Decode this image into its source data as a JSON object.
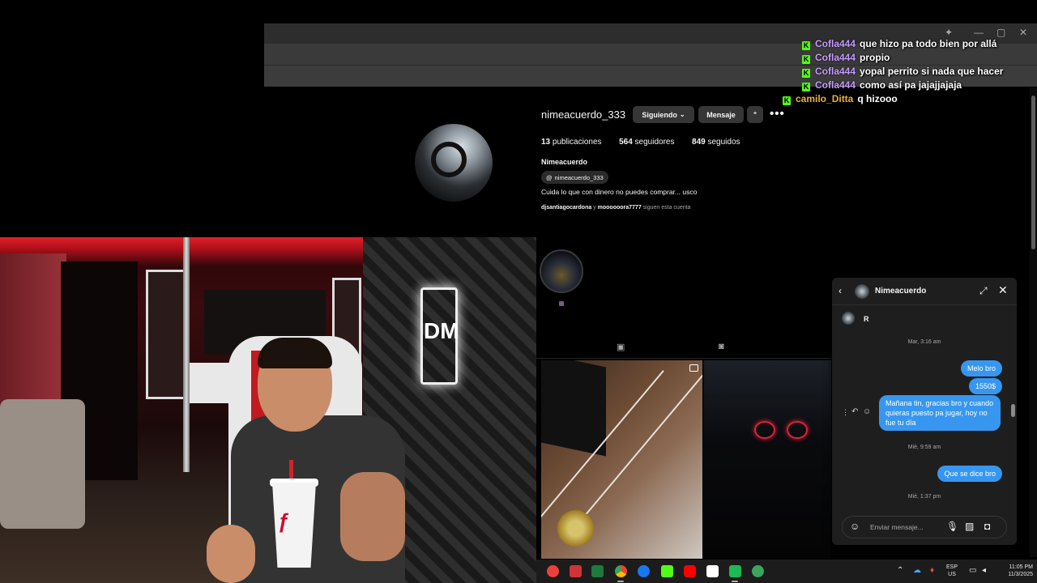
{
  "chat": [
    {
      "user": "Cofla444",
      "message": "que hizo pa todo bien por allá"
    },
    {
      "user": "Cofla444",
      "message": "propio"
    },
    {
      "user": "Cofla444",
      "message": "yopal perrito si nada que hacer"
    },
    {
      "user": "Cofla444",
      "message": "como así pa jajajjajaja"
    },
    {
      "user": "camilo_Ditta",
      "message": "q hizooo"
    }
  ],
  "chat_badge": "K",
  "profile": {
    "username": "nimeacuerdo_333",
    "following_button": "Siguiendo",
    "message_button": "Mensaje",
    "posts_count": "13",
    "posts_label": "publicaciones",
    "followers_count": "564",
    "followers_label": "seguidores",
    "following_count": "849",
    "following_label": "seguidos",
    "display_name": "Nimeacuerdo",
    "threads_handle": "nimeacuerdo_333",
    "bio": "Cuida lo que con dinero no puedes comprar... usco",
    "followed_by_1": "djsantiagocardona",
    "followed_by_sep": "y",
    "followed_by_2": "moooooora7777",
    "followed_by_suffix": "siguen esta cuenta"
  },
  "dm": {
    "contact_name": "Nimeacuerdo",
    "first_message": "R",
    "timestamps": [
      "Mar, 3:16 am",
      "Mié, 9:59 am",
      "Mié, 1:37 pm"
    ],
    "sent_messages": [
      "Melo bro",
      "1550$",
      "Mañana tin, gracias bro y cuando quieras puesto pa jugar, hoy no fue tu día",
      "Que se dice bro"
    ],
    "input_placeholder": "Enviar mensaje..."
  },
  "cam": {
    "wall_logo": "DM"
  },
  "taskbar": {
    "language": "ESP",
    "region": "US",
    "time": "11:05 PM",
    "date": "11/3/2025"
  },
  "colors": {
    "accent_blue": "#3797f0",
    "kick_green": "#53fc18",
    "chat_user": "#c79bff",
    "chat_user_alt": "#e8b03a"
  }
}
